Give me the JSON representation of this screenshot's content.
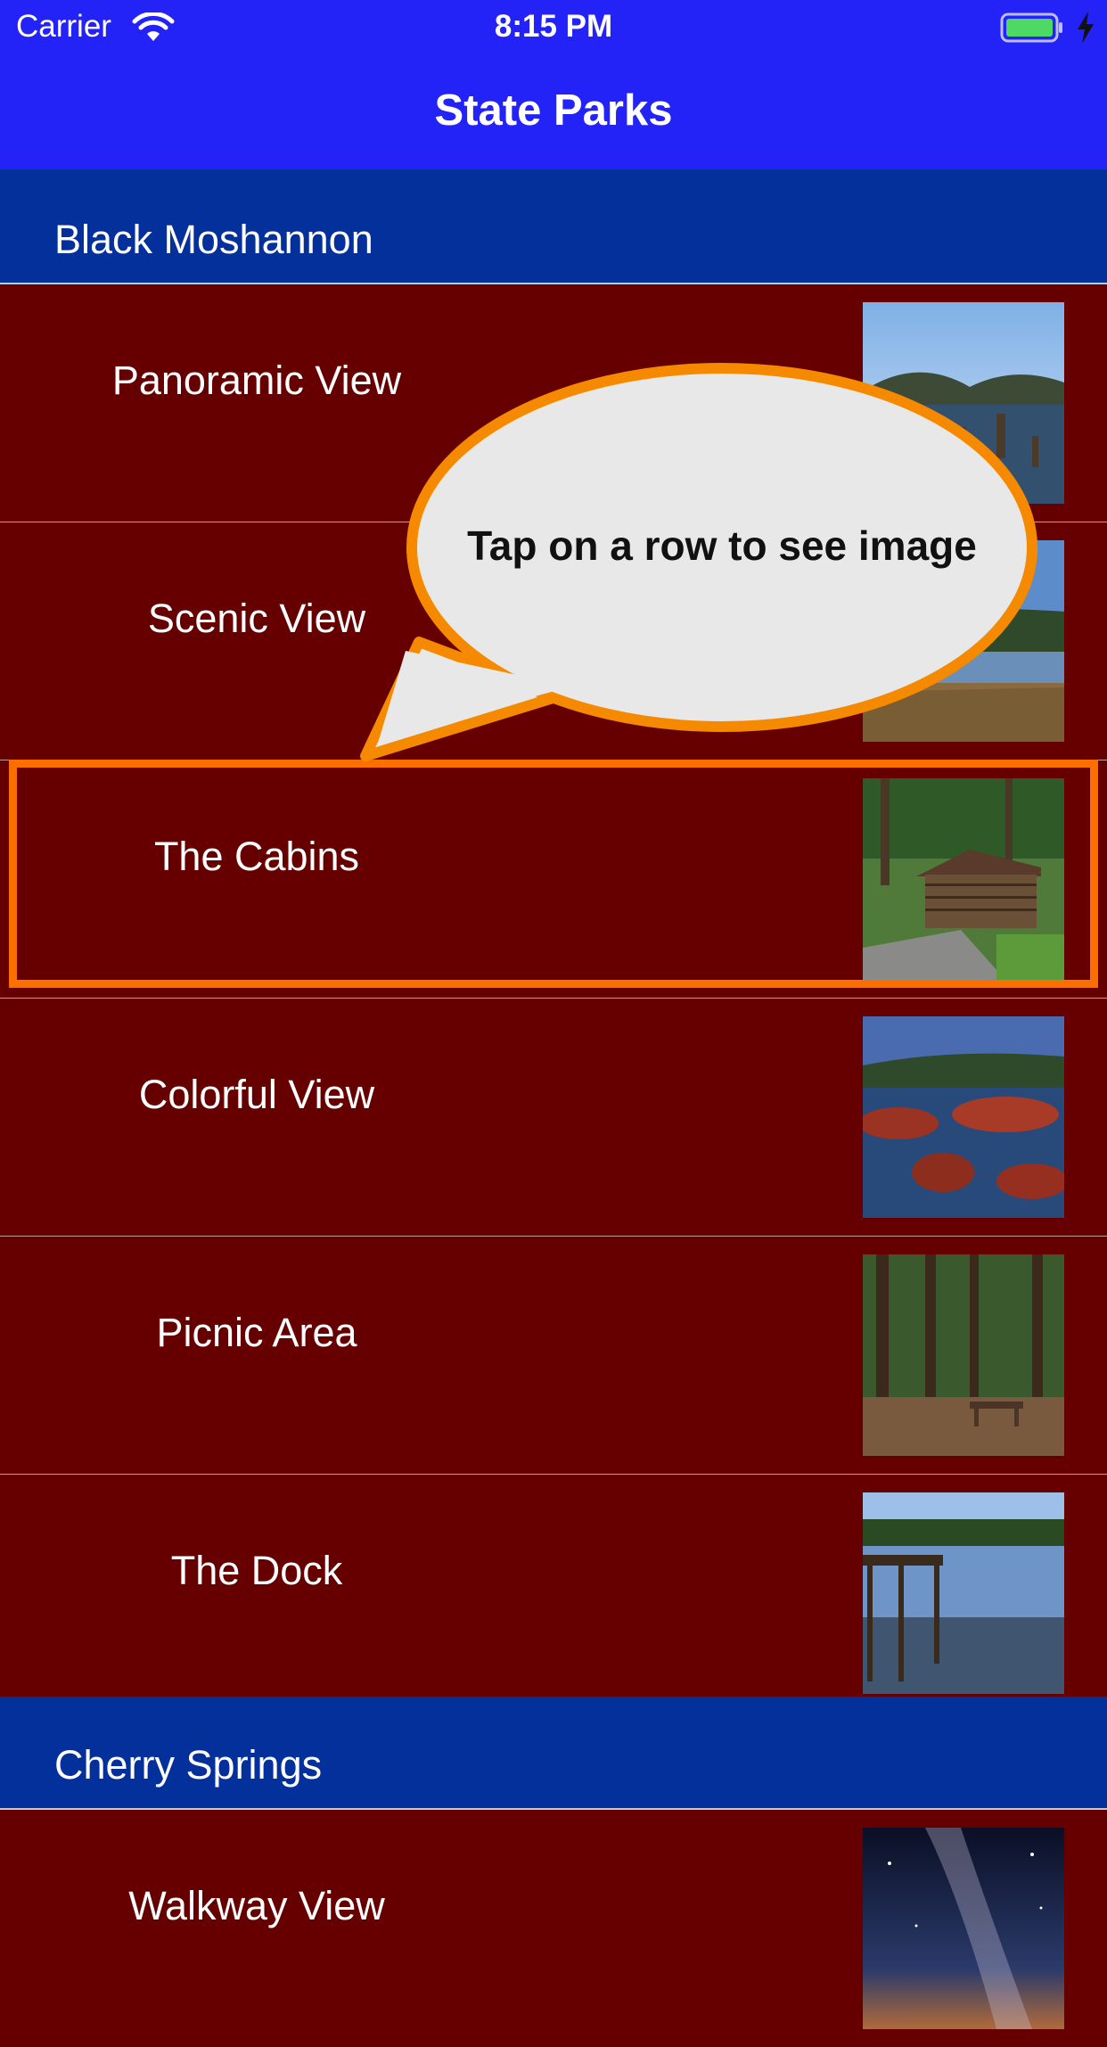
{
  "status_bar": {
    "carrier": "Carrier",
    "time": "8:15 PM",
    "icons": [
      "wifi-icon",
      "battery-icon",
      "charging-bolt-icon"
    ]
  },
  "nav": {
    "title": "State Parks"
  },
  "sections": [
    {
      "header": "Black Moshannon",
      "rows": [
        {
          "label": "Panoramic View",
          "thumbnail": "lake-panorama-photo"
        },
        {
          "label": "Scenic View",
          "thumbnail": "marsh-lake-photo"
        },
        {
          "label": "The Cabins",
          "thumbnail": "log-cabins-photo"
        },
        {
          "label": "Colorful View",
          "thumbnail": "red-bog-photo"
        },
        {
          "label": "Picnic Area",
          "thumbnail": "picnic-tables-photo"
        },
        {
          "label": "The Dock",
          "thumbnail": "dock-lake-photo"
        }
      ]
    },
    {
      "header": "Cherry Springs",
      "rows": [
        {
          "label": "Walkway View",
          "thumbnail": "milky-way-photo"
        }
      ]
    }
  ],
  "callout": {
    "text": "Tap on a row to see image"
  },
  "colors": {
    "nav_bar": "#2323f7",
    "section_header": "#03309a",
    "row_background": "#660000",
    "highlight": "#fa6f00",
    "callout_fill": "#e8e8e8",
    "callout_border": "#f58a00"
  }
}
